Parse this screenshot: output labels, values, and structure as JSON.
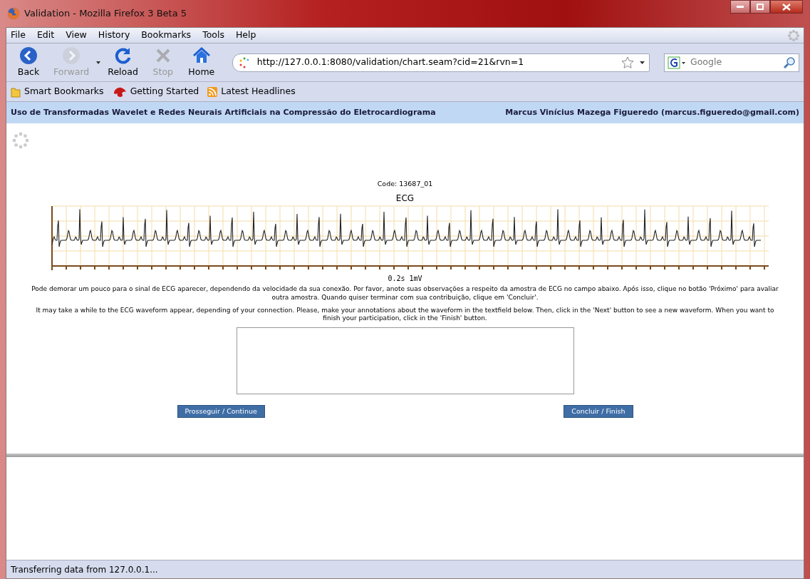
{
  "window": {
    "title": "Validation - Mozilla Firefox 3 Beta 5"
  },
  "menu": [
    "File",
    "Edit",
    "View",
    "History",
    "Bookmarks",
    "Tools",
    "Help"
  ],
  "toolbar": [
    {
      "kind": "back",
      "label": "Back",
      "disabled": false
    },
    {
      "kind": "forward",
      "label": "Forward",
      "disabled": true
    },
    {
      "kind": "reload",
      "label": "Reload",
      "disabled": false
    },
    {
      "kind": "stop",
      "label": "Stop",
      "disabled": true
    },
    {
      "kind": "home",
      "label": "Home",
      "disabled": false
    }
  ],
  "address": {
    "url": "http://127.0.0.1:8080/validation/chart.seam?cid=21&rvn=1"
  },
  "search": {
    "placeholder": "Google"
  },
  "bookmarks": [
    {
      "kind": "folder",
      "label": "Smart Bookmarks"
    },
    {
      "kind": "firefox",
      "label": "Getting Started"
    },
    {
      "kind": "feed",
      "label": "Latest Headlines"
    }
  ],
  "page": {
    "header_title": "Uso de Transformadas Wavelet e Redes Neurais Artificiais na Compressão do Eletrocardiograma",
    "header_author": "Marcus Vinícius Mazega Figueredo (marcus.figueredo@gmail.com)",
    "code": "Code: 13687_01",
    "chart_title": "ECG",
    "scale_label": "0.2s 1mV",
    "text_pt": "Pode demorar um pouco para o sinal de ECG aparecer, dependendo da velocidade da sua conexão. Por favor, anote suas observações a respeito da amostra de ECG no campo abaixo. Após isso, clique no botão 'Próximo' para avaliar outra amostra. Quando quiser terminar com sua contribuição, clique em 'Concluir'.",
    "text_en": "It may take a while to the ECG waveform appear, depending of your connection. Please, make your annotations about the waveform in the textfield below. Then, click in the 'Next' button to see a new waveform. When you want to finish your participation, click in the 'Finish' button.",
    "buttons": [
      {
        "label": "Prosseguir / Continue"
      },
      {
        "label": "Concluir / Finish"
      }
    ]
  },
  "status_bar": {
    "text": "Transferring data from 127.0.0.1..."
  }
}
